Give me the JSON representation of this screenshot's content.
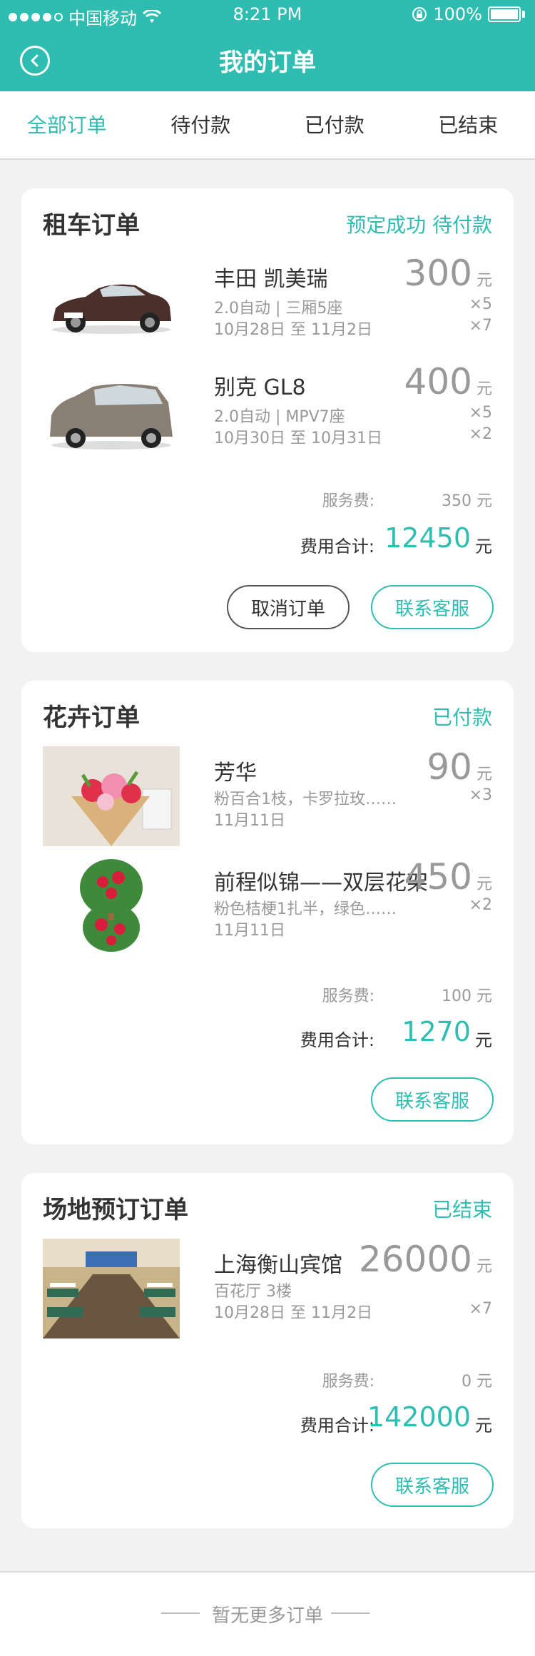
{
  "status_bar": {
    "carrier": "中国移动",
    "time": "8:21 PM",
    "battery": "100%"
  },
  "nav": {
    "title": "我的订单"
  },
  "tabs": [
    {
      "label": "全部订单",
      "active": true
    },
    {
      "label": "待付款",
      "active": false
    },
    {
      "label": "已付款",
      "active": false
    },
    {
      "label": "已结束",
      "active": false
    }
  ],
  "orders": [
    {
      "title": "租车订单",
      "status": "预定成功 待付款",
      "items": [
        {
          "name": "丰田 凯美瑞",
          "spec": "2.0自动 | 三厢5座",
          "dates": "10月28日 至 11月2日",
          "price": "300",
          "unit": "元",
          "qty1": "×5",
          "qty2": "×7",
          "image": "car-sedan"
        },
        {
          "name": "别克 GL8",
          "spec": "2.0自动 | MPV7座",
          "dates": "10月30日 至 10月31日",
          "price": "400",
          "unit": "元",
          "qty1": "×5",
          "qty2": "×2",
          "image": "car-mpv"
        }
      ],
      "service_label": "服务费:",
      "service_fee": "350 元",
      "total_label": "费用合计:",
      "total": "12450",
      "total_unit": "元",
      "buttons": [
        "取消订单",
        "联系客服"
      ]
    },
    {
      "title": "花卉订单",
      "status": "已付款",
      "items": [
        {
          "name": "芳华",
          "spec": "粉百合1枝，卡罗拉玫……",
          "dates": "11月11日",
          "price": "90",
          "unit": "元",
          "qty1": "×3",
          "image": "flower-bouquet"
        },
        {
          "name": "前程似锦——双层花架",
          "spec": "粉色桔梗1扎半，绿色……",
          "dates": "11月11日",
          "price": "450",
          "unit": "元",
          "qty1": "×2",
          "image": "flower-stand"
        }
      ],
      "service_label": "服务费:",
      "service_fee": "100 元",
      "total_label": "费用合计:",
      "total": "1270",
      "total_unit": "元",
      "buttons": [
        "联系客服"
      ]
    },
    {
      "title": "场地预订订单",
      "status": "已结束",
      "items": [
        {
          "name": "上海衡山宾馆",
          "spec": "百花厅 3楼",
          "dates": "10月28日 至 11月2日",
          "price": "26000",
          "unit": "元",
          "qty1": "×7",
          "image": "venue-hall"
        }
      ],
      "service_label": "服务费:",
      "service_fee": "0 元",
      "total_label": "费用合计:",
      "total": "142000",
      "total_unit": "元",
      "buttons": [
        "联系客服"
      ]
    }
  ],
  "footer": {
    "text": "暂无更多订单"
  },
  "colors": {
    "accent": "#2fbdb1",
    "background": "#f2f2f2"
  }
}
